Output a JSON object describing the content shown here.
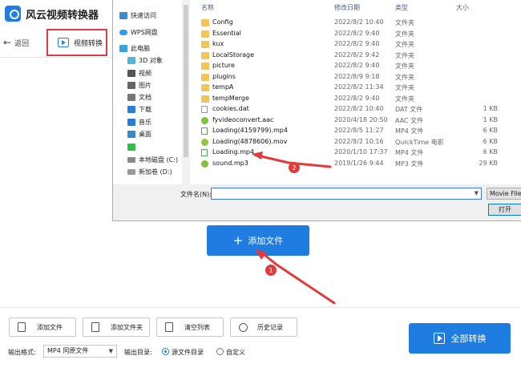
{
  "app": {
    "name": "风云视频转换器"
  },
  "nav": {
    "back_label": "返回",
    "tab_label": "视频转换"
  },
  "dialog": {
    "sidebar": [
      {
        "icon": "star-icon",
        "label": "快速访问"
      },
      {
        "icon": "cloud-icon",
        "label": "WPS网盘"
      },
      {
        "icon": "computer-icon",
        "label": "此电脑"
      },
      {
        "icon": "cube-icon",
        "label": "3D 对象"
      },
      {
        "icon": "video-icon",
        "label": "视频"
      },
      {
        "icon": "picture-icon",
        "label": "图片"
      },
      {
        "icon": "document-icon",
        "label": "文档"
      },
      {
        "icon": "download-icon",
        "label": "下载"
      },
      {
        "icon": "music-icon",
        "label": "音乐"
      },
      {
        "icon": "desktop-icon",
        "label": "桌面"
      },
      {
        "icon": "green-app-icon",
        "label": ""
      },
      {
        "icon": "disk-icon",
        "label": "本地磁盘 (C:)"
      },
      {
        "icon": "volume-icon",
        "label": "新加卷 (D:)"
      }
    ],
    "columns": {
      "name": "名称",
      "date": "修改日期",
      "type": "类型",
      "size": "大小"
    },
    "files": [
      {
        "kind": "folder",
        "name": "Config",
        "date": "2022/8/2 10:40",
        "type": "文件夹",
        "size": ""
      },
      {
        "kind": "folder",
        "name": "Essential",
        "date": "2022/8/2 9:40",
        "type": "文件夹",
        "size": ""
      },
      {
        "kind": "folder",
        "name": "kux",
        "date": "2022/8/2 9:40",
        "type": "文件夹",
        "size": ""
      },
      {
        "kind": "folder",
        "name": "LocalStorage",
        "date": "2022/8/2 9:42",
        "type": "文件夹",
        "size": ""
      },
      {
        "kind": "folder",
        "name": "picture",
        "date": "2022/8/2 9:40",
        "type": "文件夹",
        "size": ""
      },
      {
        "kind": "folder",
        "name": "plugins",
        "date": "2022/8/9 9:18",
        "type": "文件夹",
        "size": ""
      },
      {
        "kind": "folder",
        "name": "tempA",
        "date": "2022/8/2 11:34",
        "type": "文件夹",
        "size": ""
      },
      {
        "kind": "folder",
        "name": "tempMerge",
        "date": "2022/8/2 9:40",
        "type": "文件夹",
        "size": ""
      },
      {
        "kind": "file",
        "name": "cookies.dat",
        "date": "2022/8/2 10:40",
        "type": "DAT 文件",
        "size": "1 KB"
      },
      {
        "kind": "aac",
        "name": "fyvideoconvert.aac",
        "date": "2020/4/18 20:50",
        "type": "AAC 文件",
        "size": "1 KB"
      },
      {
        "kind": "mp4",
        "name": "Loading(4159799).mp4",
        "date": "2022/8/5 11:27",
        "type": "MP4 文件",
        "size": "6 KB"
      },
      {
        "kind": "mov",
        "name": "Loading(4878606).mov",
        "date": "2022/8/2 10:16",
        "type": "QuickTime 电影",
        "size": "6 KB"
      },
      {
        "kind": "mp4",
        "name": "Loading.mp4",
        "date": "2020/1/10 17:37",
        "type": "MP4 文件",
        "size": "6 KB"
      },
      {
        "kind": "aac",
        "name": "sound.mp3",
        "date": "2019/1/26 9:44",
        "type": "MP3 文件",
        "size": "29 KB"
      }
    ],
    "filename_label": "文件名(N):",
    "filename_value": "",
    "filter_value": "Movie Files",
    "open_label": "打开(O)"
  },
  "main": {
    "add_file_label": "添加文件"
  },
  "annotations": [
    {
      "label": "1"
    },
    {
      "label": "2"
    }
  ],
  "toolbar": {
    "add_file": "添加文件",
    "add_folder": "添加文件夹",
    "clear_list": "清空列表",
    "history": "历史记录",
    "convert_all": "全部转换"
  },
  "output": {
    "format_label": "输出格式:",
    "format_value": "MP4 同原文件",
    "dir_label": "输出目录:",
    "source_dir": "源文件目录",
    "custom": "自定义",
    "selected": "source_dir"
  },
  "colors": {
    "accent": "#1f7de2",
    "annotation_red": "#e23b3b",
    "folder": "#f2c55c"
  }
}
